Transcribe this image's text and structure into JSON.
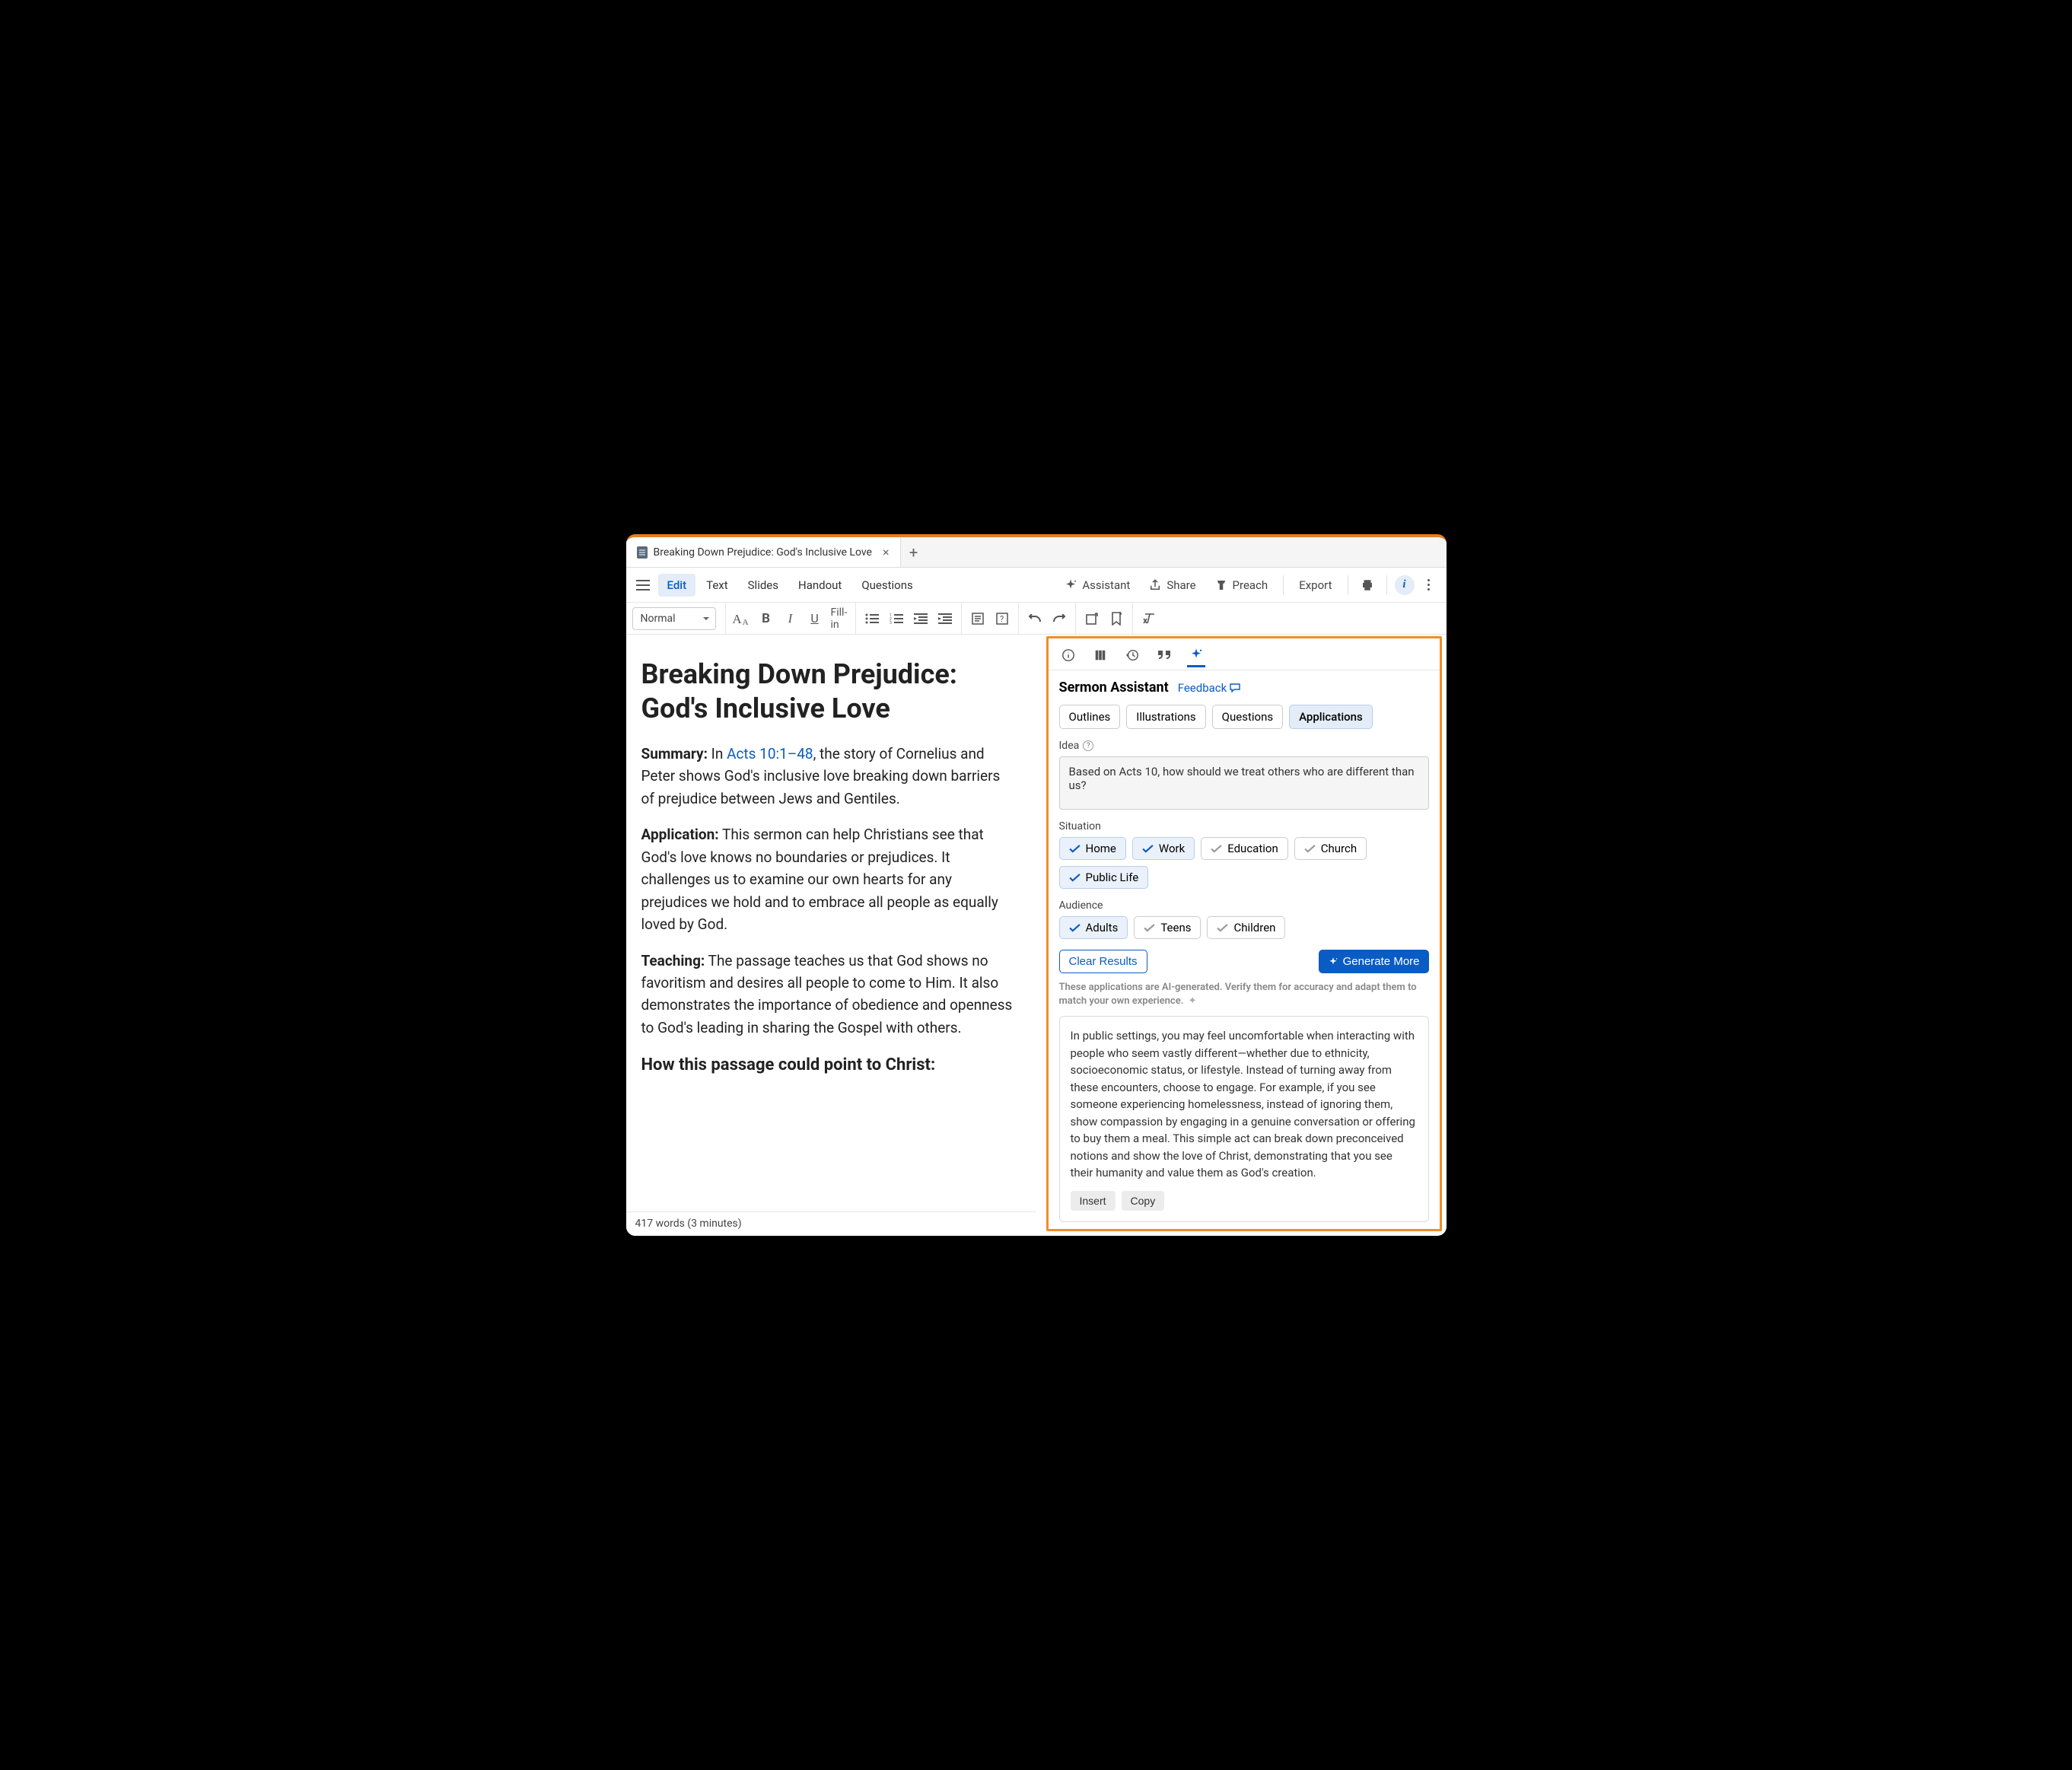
{
  "tab": {
    "title": "Breaking Down Prejudice: God's Inclusive Love"
  },
  "viewTabs": [
    "Edit",
    "Text",
    "Slides",
    "Handout",
    "Questions"
  ],
  "activeViewTab": "Edit",
  "topActions": {
    "assistant": "Assistant",
    "share": "Share",
    "preach": "Preach",
    "export": "Export"
  },
  "styleSelect": "Normal",
  "fillin": "Fill-in",
  "document": {
    "title": "Breaking Down Prejudice: God's Inclusive Love",
    "summaryLabel": "Summary:",
    "summaryPrefix": " In ",
    "summaryLink": "Acts 10:1–48",
    "summaryRest": ", the story of Cornelius and Peter shows God's inclusive love breaking down barriers of prejudice between Jews and Gentiles.",
    "applicationLabel": "Application:",
    "applicationText": " This sermon can help Christians see that God's love knows no boundaries or prejudices. It challenges us to examine our own hearts for any prejudices we hold and to embrace all people as equally loved by God.",
    "teachingLabel": "Teaching:",
    "teachingText": " The passage teaches us that God shows no favoritism and desires all people to come to Him. It also demonstrates the importance of obedience and openness to God's leading in sharing the Gospel with others.",
    "cutoffHeading": "How this passage could point to Christ:"
  },
  "statusbar": {
    "text": "417 words (3 minutes)"
  },
  "panel": {
    "title": "Sermon Assistant",
    "feedback": "Feedback",
    "modes": [
      "Outlines",
      "Illustrations",
      "Questions",
      "Applications"
    ],
    "activeMode": "Applications",
    "ideaLabel": "Idea",
    "ideaText": "Based on Acts 10, how should we treat others who are different than us?",
    "situationLabel": "Situation",
    "situations": [
      {
        "label": "Home",
        "selected": true
      },
      {
        "label": "Work",
        "selected": true
      },
      {
        "label": "Education",
        "selected": false
      },
      {
        "label": "Church",
        "selected": false
      },
      {
        "label": "Public Life",
        "selected": true
      }
    ],
    "audienceLabel": "Audience",
    "audiences": [
      {
        "label": "Adults",
        "selected": true
      },
      {
        "label": "Teens",
        "selected": false
      },
      {
        "label": "Children",
        "selected": false
      }
    ],
    "clearResults": "Clear Results",
    "generateMore": "Generate More",
    "disclaimer": "These applications are AI-generated. Verify them for accuracy and adapt them to match your own experience.",
    "resultText": "In public settings, you may feel uncomfortable when interacting with people who seem vastly different—whether due to ethnicity, socioeconomic status, or lifestyle. Instead of turning away from these encounters, choose to engage. For example, if you see someone experiencing homelessness, instead of ignoring them, show compassion by engaging in a genuine conversation or offering to buy them a meal. This simple act can break down preconceived notions and show the love of Christ, demonstrating that you see their humanity and value them as God's creation.",
    "insert": "Insert",
    "copy": "Copy"
  }
}
